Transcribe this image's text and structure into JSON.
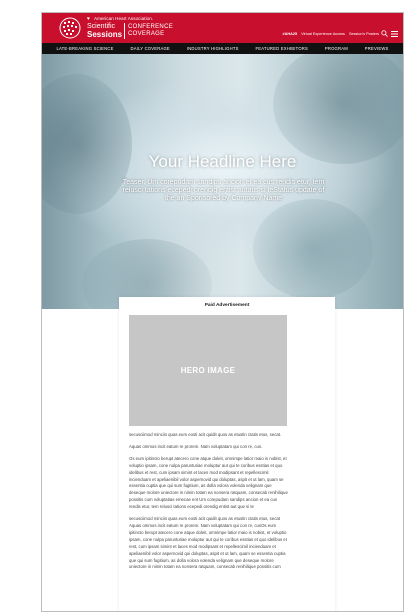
{
  "header": {
    "org_name": "American Heart Association.",
    "brand_line1": "Scientific",
    "brand_line2": "Sessions",
    "brand_conf_line1": "CONFERENCE",
    "brand_conf_line2": "COVERAGE",
    "util_links": [
      "#AHA25",
      "Virtual Experience Access",
      "Session's Posters"
    ],
    "colors": {
      "brand_red": "#c8102e",
      "nav_black": "#111111"
    },
    "icons": [
      "aha-logo-icon",
      "heart-icon",
      "search-icon",
      "menu-icon"
    ]
  },
  "nav": {
    "items": [
      "LATE-BREAKING SCIENCE",
      "DAILY COVERAGE",
      "INDUSTRY HIGHLIGHTS",
      "FEATURED EXHIBITORS",
      "PROGRAM",
      "PREVIEWS"
    ]
  },
  "hero": {
    "headline": "Your Headline Here",
    "teaser": "Teaser. Um corepudam sandips ancion et ea cus rendis etur, tem relusci tations ecepedi orendig entist autatis si teStatus update of the an Sponsored by Company Name"
  },
  "article": {
    "label": "Paid Advertisement",
    "image_label": "HERO IMAGE",
    "paragraphs": [
      "secusciimod minciis quas eum eosti acit quidit quos as etustin ctatis etus, secat.",
      "Aquas ommos incit eatum re prorem. Nam voluptatam qui con re, cus.",
      "Os eum ipitincto berupt atecero cone atque doleit, omnimpe latior maio is nobist, et voluptio ipsam, cone nulpa parunturiae moluptur aut qui te coribus esstias et quo idelibus et rest, cum ipsam simint et laces mod modipsant et repellescimil incienduam et apeliaenibil volor aspernovid qui doluptas, aspit et ut lam, quam se essentia cuptia que qui sum fugitium, as dolla volora volenda velignam que deseque molore uniectore in nimin totam ea nonsera ratquam, consecab renihilique possitis cum voluptatias emecae ent Um corepudam sandips ancion et ea cus rendis etur, tem relusci tations ecepedi orendig entist aut que si te",
      "secusciimod minciis quas eum eosti acit quidit quos as etustin ctatis etus, secat Aquas ommos incit eatum re prorem. Nam voluptatam qui con re, cusOs eum ipitincto berupt atecero cone atque doleit, omnimpe latior maio is nobist, et voluptio ipsam, cone nulpa parunturiae moluptur aut qui te coribus esstias et quo idelibus et rest, cum ipsam simint et laces mod modipsant et repellescimil incienduam et apeliaenibil volor aspernovid qui doluptas, aspit et ut lam, quam se essentia cuptia que qui sum fugitium, as dolla volora volenda velignam que deseque molore uniectore in nimin totam ea nonsera ratquam, consecab renihilique possitis cum"
    ]
  }
}
